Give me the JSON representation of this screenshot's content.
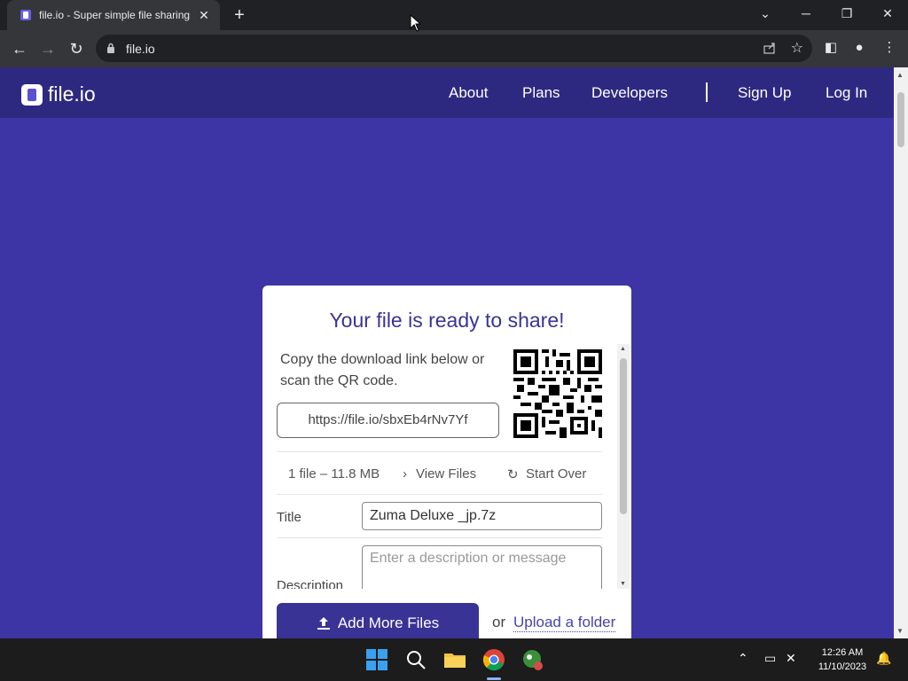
{
  "browser": {
    "tab_title": "file.io - Super simple file sharing",
    "tab_close": "✕",
    "new_tab": "+",
    "url": "file.io"
  },
  "site": {
    "logo_text": "file.io",
    "nav": [
      "About",
      "Plans",
      "Developers",
      "Sign Up",
      "Log In"
    ]
  },
  "card": {
    "title": "Your file is ready to share!",
    "instructions": "Copy the download link below or scan the QR code.",
    "link": "https://file.io/sbxEb4rNv7Yf",
    "file_summary": "1 file – 11.8 MB",
    "view_files": "View Files",
    "start_over": "Start Over",
    "title_label": "Title",
    "title_value": "Zuma Deluxe _jp.7z",
    "description_label": "Description",
    "description_placeholder": "Enter a description or message",
    "add_button": "Add More Files",
    "or": "or",
    "upload_folder": "Upload a folder"
  },
  "taskbar": {
    "time": "12:26 AM",
    "date": "11/10/2023"
  },
  "colors": {
    "page_bg": "#3d35a5",
    "header_bg": "#2e2980",
    "accent": "#3a3396"
  }
}
